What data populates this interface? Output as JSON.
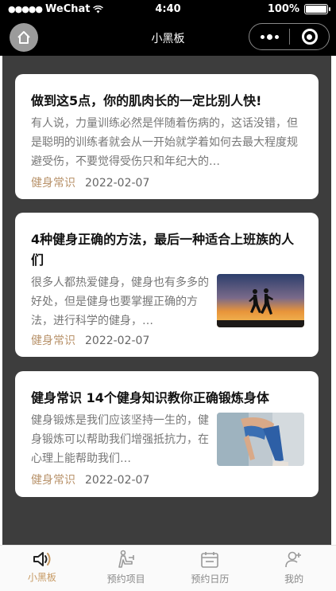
{
  "status_bar": {
    "carrier": "WeChat",
    "time": "4:40",
    "battery": "100%"
  },
  "nav": {
    "title": "小黑板"
  },
  "articles": [
    {
      "title": "做到这5点，你的肌肉长的一定比别人快!",
      "excerpt": "有人说，力量训练必然是伴随着伤病的，这话没错，但是聪明的训练者就会从一开始就学着如何去最大程度规避受伤，不要觉得受伤只和年纪大的…",
      "tag": "健身常识",
      "date": "2022-02-07",
      "has_image": false
    },
    {
      "title": "4种健身正确的方法，最后一种适合上班族的人们",
      "excerpt": "很多人都热爱健身，健身也有多多的好处，但是健身也要掌握正确的方法，进行科学的健身，…",
      "tag": "健身常识",
      "date": "2022-02-07",
      "has_image": true,
      "image": "runners-sunset-photo"
    },
    {
      "title": "健身常识 14个健身知识教你正确锻炼身体",
      "excerpt": "健身锻炼是我们应该坚持一生的，健身锻炼可以帮助我们增强抵抗力，在心理上能帮助我们…",
      "tag": "健身常识",
      "date": "2022-02-07",
      "has_image": true,
      "image": "stretching-woman-photo"
    }
  ],
  "tabs": [
    {
      "label": "小黑板",
      "icon": "speaker-icon",
      "active": true
    },
    {
      "label": "预约项目",
      "icon": "exercise-icon",
      "active": false
    },
    {
      "label": "预约日历",
      "icon": "calendar-icon",
      "active": false
    },
    {
      "label": "我的",
      "icon": "user-add-icon",
      "active": false
    }
  ],
  "colors": {
    "accent": "#c79a64",
    "tag": "#b8926a",
    "content_bg": "#3d3d3d"
  }
}
